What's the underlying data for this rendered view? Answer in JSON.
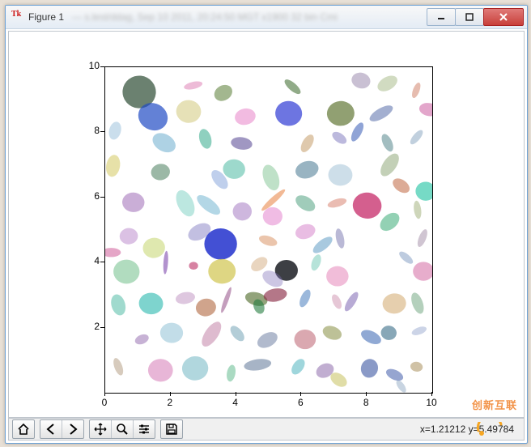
{
  "window": {
    "title": "Figure 1",
    "blurred_text": "— s.test/ddag, Sep 10 2011, 20:24:50  MGT x1900 32 bin  Cmi"
  },
  "win_buttons": {
    "minimize": "minimize-button",
    "maximize": "maximize-button",
    "close": "close-button"
  },
  "toolbar": {
    "home": "Home",
    "back": "Back",
    "forward": "Forward",
    "pan": "Pan",
    "zoom": "Zoom",
    "subplots": "Configure subplots",
    "save": "Save"
  },
  "status": {
    "coords": "x=1.21212   y=5.49784"
  },
  "watermark": "创新互联",
  "chart_data": {
    "type": "scatter",
    "title": "",
    "xlabel": "",
    "ylabel": "",
    "xlim": [
      0,
      10
    ],
    "ylim": [
      0,
      10
    ],
    "xticks": [
      0,
      2,
      4,
      6,
      8,
      10
    ],
    "yticks": [
      2,
      4,
      6,
      8,
      10
    ],
    "note": "100 translucent ellipses with random position, size, rotation, and color",
    "series": [
      {
        "x": 1.04,
        "y": 9.24,
        "rx": 0.51,
        "ry": 0.5,
        "angle": 6,
        "color": "#2c4c33",
        "alpha": 0.7
      },
      {
        "x": 2.69,
        "y": 9.44,
        "rx": 0.29,
        "ry": 0.11,
        "angle": 167,
        "color": "#d86aa8",
        "alpha": 0.46
      },
      {
        "x": 3.61,
        "y": 9.21,
        "rx": 0.23,
        "ry": 0.29,
        "angle": 60,
        "color": "#6a8a4b",
        "alpha": 0.62
      },
      {
        "x": 5.73,
        "y": 9.4,
        "rx": 0.12,
        "ry": 0.31,
        "angle": 131,
        "color": "#3a6a2b",
        "alpha": 0.56
      },
      {
        "x": 7.82,
        "y": 9.59,
        "rx": 0.29,
        "ry": 0.24,
        "angle": 15,
        "color": "#9482a7",
        "alpha": 0.5
      },
      {
        "x": 8.63,
        "y": 9.5,
        "rx": 0.33,
        "ry": 0.2,
        "angle": 150,
        "color": "#a3b884",
        "alpha": 0.5
      },
      {
        "x": 9.51,
        "y": 9.29,
        "rx": 0.1,
        "ry": 0.25,
        "angle": 21,
        "color": "#d1846b",
        "alpha": 0.54
      },
      {
        "x": 1.46,
        "y": 8.48,
        "rx": 0.46,
        "ry": 0.41,
        "angle": 28,
        "color": "#1d49c4",
        "alpha": 0.69
      },
      {
        "x": 2.55,
        "y": 8.64,
        "rx": 0.38,
        "ry": 0.35,
        "angle": 4,
        "color": "#d7ce8b",
        "alpha": 0.62
      },
      {
        "x": 4.28,
        "y": 8.48,
        "rx": 0.32,
        "ry": 0.25,
        "angle": 348,
        "color": "#e88acb",
        "alpha": 0.58
      },
      {
        "x": 5.61,
        "y": 8.58,
        "rx": 0.41,
        "ry": 0.38,
        "angle": 7,
        "color": "#1f2bd1",
        "alpha": 0.65
      },
      {
        "x": 7.2,
        "y": 8.58,
        "rx": 0.42,
        "ry": 0.38,
        "angle": 355,
        "color": "#667c3c",
        "alpha": 0.72
      },
      {
        "x": 8.44,
        "y": 8.58,
        "rx": 0.4,
        "ry": 0.16,
        "angle": 330,
        "color": "#3f579c",
        "alpha": 0.48
      },
      {
        "x": 9.9,
        "y": 8.7,
        "rx": 0.3,
        "ry": 0.2,
        "angle": 10,
        "color": "#cc5ca0",
        "alpha": 0.55
      },
      {
        "x": 0.3,
        "y": 8.05,
        "rx": 0.18,
        "ry": 0.28,
        "angle": 15,
        "color": "#8ab6d4",
        "alpha": 0.45
      },
      {
        "x": 1.8,
        "y": 7.68,
        "rx": 0.26,
        "ry": 0.38,
        "angle": 120,
        "color": "#4e9cc5",
        "alpha": 0.46
      },
      {
        "x": 3.06,
        "y": 7.8,
        "rx": 0.18,
        "ry": 0.31,
        "angle": 165,
        "color": "#33a98a",
        "alpha": 0.55
      },
      {
        "x": 4.17,
        "y": 7.66,
        "rx": 0.19,
        "ry": 0.33,
        "angle": 98,
        "color": "#5c4c96",
        "alpha": 0.58
      },
      {
        "x": 6.18,
        "y": 7.66,
        "rx": 0.15,
        "ry": 0.3,
        "angle": 30,
        "color": "#c59c6a",
        "alpha": 0.55
      },
      {
        "x": 7.16,
        "y": 7.83,
        "rx": 0.14,
        "ry": 0.25,
        "angle": 125,
        "color": "#7a73bb",
        "alpha": 0.5
      },
      {
        "x": 7.71,
        "y": 8.01,
        "rx": 0.13,
        "ry": 0.32,
        "angle": 28,
        "color": "#2b50b1",
        "alpha": 0.52
      },
      {
        "x": 8.63,
        "y": 7.68,
        "rx": 0.14,
        "ry": 0.29,
        "angle": 155,
        "color": "#3d757b",
        "alpha": 0.48
      },
      {
        "x": 9.52,
        "y": 7.85,
        "rx": 0.11,
        "ry": 0.27,
        "angle": 40,
        "color": "#6b8fb0",
        "alpha": 0.42
      },
      {
        "x": 0.24,
        "y": 6.97,
        "rx": 0.21,
        "ry": 0.34,
        "angle": 10,
        "color": "#d3c960",
        "alpha": 0.55
      },
      {
        "x": 1.69,
        "y": 6.78,
        "rx": 0.29,
        "ry": 0.25,
        "angle": 350,
        "color": "#4c8061",
        "alpha": 0.56
      },
      {
        "x": 3.94,
        "y": 6.87,
        "rx": 0.34,
        "ry": 0.3,
        "angle": 5,
        "color": "#49b9a1",
        "alpha": 0.54
      },
      {
        "x": 3.5,
        "y": 6.55,
        "rx": 0.18,
        "ry": 0.34,
        "angle": 142,
        "color": "#5e86d0",
        "alpha": 0.4
      },
      {
        "x": 5.07,
        "y": 6.61,
        "rx": 0.23,
        "ry": 0.41,
        "angle": 160,
        "color": "#7fc391",
        "alpha": 0.5
      },
      {
        "x": 6.17,
        "y": 6.85,
        "rx": 0.26,
        "ry": 0.36,
        "angle": 74,
        "color": "#2a627f",
        "alpha": 0.48
      },
      {
        "x": 7.19,
        "y": 6.69,
        "rx": 0.37,
        "ry": 0.33,
        "angle": 2,
        "color": "#a5c5d7",
        "alpha": 0.56
      },
      {
        "x": 8.7,
        "y": 7.0,
        "rx": 0.2,
        "ry": 0.4,
        "angle": 35,
        "color": "#6a8a4b",
        "alpha": 0.4
      },
      {
        "x": 9.05,
        "y": 6.36,
        "rx": 0.18,
        "ry": 0.29,
        "angle": 125,
        "color": "#c06640",
        "alpha": 0.55
      },
      {
        "x": 9.8,
        "y": 6.19,
        "rx": 0.31,
        "ry": 0.29,
        "angle": 5,
        "color": "#29c5a6",
        "alpha": 0.64
      },
      {
        "x": 0.86,
        "y": 5.85,
        "rx": 0.34,
        "ry": 0.3,
        "angle": 3,
        "color": "#a16fb7",
        "alpha": 0.56
      },
      {
        "x": 2.45,
        "y": 5.82,
        "rx": 0.24,
        "ry": 0.43,
        "angle": 155,
        "color": "#67c9b9",
        "alpha": 0.44
      },
      {
        "x": 3.16,
        "y": 5.77,
        "rx": 0.18,
        "ry": 0.43,
        "angle": 128,
        "color": "#49a0c3",
        "alpha": 0.42
      },
      {
        "x": 4.19,
        "y": 5.57,
        "rx": 0.29,
        "ry": 0.28,
        "angle": 1,
        "color": "#a77fc5",
        "alpha": 0.56
      },
      {
        "x": 5.12,
        "y": 5.42,
        "rx": 0.3,
        "ry": 0.28,
        "angle": 2,
        "color": "#e68bd0",
        "alpha": 0.58
      },
      {
        "x": 5.14,
        "y": 5.92,
        "rx": 0.09,
        "ry": 0.48,
        "angle": 48,
        "color": "#e6742b",
        "alpha": 0.5
      },
      {
        "x": 6.12,
        "y": 5.82,
        "rx": 0.2,
        "ry": 0.33,
        "angle": 122,
        "color": "#38956f",
        "alpha": 0.48
      },
      {
        "x": 7.09,
        "y": 5.83,
        "rx": 0.12,
        "ry": 0.3,
        "angle": 74,
        "color": "#d06a55",
        "alpha": 0.45
      },
      {
        "x": 8.01,
        "y": 5.75,
        "rx": 0.44,
        "ry": 0.4,
        "angle": 8,
        "color": "#c32162",
        "alpha": 0.72
      },
      {
        "x": 8.7,
        "y": 5.25,
        "rx": 0.22,
        "ry": 0.34,
        "angle": 50,
        "color": "#1d9e62",
        "alpha": 0.48
      },
      {
        "x": 9.55,
        "y": 5.62,
        "rx": 0.11,
        "ry": 0.28,
        "angle": 172,
        "color": "#8a9d5a",
        "alpha": 0.42
      },
      {
        "x": 0.72,
        "y": 4.81,
        "rx": 0.28,
        "ry": 0.25,
        "angle": 354,
        "color": "#bc8cce",
        "alpha": 0.54
      },
      {
        "x": 0.18,
        "y": 4.31,
        "rx": 0.14,
        "ry": 0.3,
        "angle": 90,
        "color": "#d46aa2",
        "alpha": 0.6
      },
      {
        "x": 1.49,
        "y": 4.45,
        "rx": 0.34,
        "ry": 0.31,
        "angle": 350,
        "color": "#c4d56e",
        "alpha": 0.55
      },
      {
        "x": 2.88,
        "y": 4.94,
        "rx": 0.37,
        "ry": 0.23,
        "angle": 152,
        "color": "#7b73be",
        "alpha": 0.46
      },
      {
        "x": 3.53,
        "y": 4.57,
        "rx": 0.5,
        "ry": 0.48,
        "angle": 0,
        "color": "#1a2acb",
        "alpha": 0.82
      },
      {
        "x": 4.98,
        "y": 4.67,
        "rx": 0.14,
        "ry": 0.29,
        "angle": 108,
        "color": "#d88c5a",
        "alpha": 0.5
      },
      {
        "x": 6.12,
        "y": 4.95,
        "rx": 0.31,
        "ry": 0.22,
        "angle": 342,
        "color": "#d37bc7",
        "alpha": 0.5
      },
      {
        "x": 6.65,
        "y": 4.54,
        "rx": 0.15,
        "ry": 0.36,
        "angle": 52,
        "color": "#3883b6",
        "alpha": 0.44
      },
      {
        "x": 7.18,
        "y": 4.74,
        "rx": 0.12,
        "ry": 0.31,
        "angle": 168,
        "color": "#6e6ca9",
        "alpha": 0.48
      },
      {
        "x": 9.7,
        "y": 4.75,
        "rx": 0.11,
        "ry": 0.29,
        "angle": 22,
        "color": "#8a6e8f",
        "alpha": 0.4
      },
      {
        "x": 0.65,
        "y": 3.72,
        "rx": 0.4,
        "ry": 0.37,
        "angle": 2,
        "color": "#3da85f",
        "alpha": 0.4
      },
      {
        "x": 1.85,
        "y": 4.0,
        "rx": 0.07,
        "ry": 0.36,
        "angle": 4,
        "color": "#7339a5",
        "alpha": 0.55
      },
      {
        "x": 2.7,
        "y": 3.9,
        "rx": 0.14,
        "ry": 0.12,
        "angle": 0,
        "color": "#c13c6e",
        "alpha": 0.64
      },
      {
        "x": 3.57,
        "y": 3.73,
        "rx": 0.42,
        "ry": 0.38,
        "angle": 0,
        "color": "#cfc248",
        "alpha": 0.68
      },
      {
        "x": 4.71,
        "y": 3.95,
        "rx": 0.18,
        "ry": 0.28,
        "angle": 55,
        "color": "#d2a77a",
        "alpha": 0.48
      },
      {
        "x": 5.54,
        "y": 3.76,
        "rx": 0.35,
        "ry": 0.32,
        "angle": 2,
        "color": "#1b1d23",
        "alpha": 0.85
      },
      {
        "x": 5.12,
        "y": 3.5,
        "rx": 0.21,
        "ry": 0.34,
        "angle": 120,
        "color": "#8071b9",
        "alpha": 0.4
      },
      {
        "x": 6.45,
        "y": 4.0,
        "rx": 0.13,
        "ry": 0.26,
        "angle": 20,
        "color": "#49b9a1",
        "alpha": 0.4
      },
      {
        "x": 7.1,
        "y": 3.58,
        "rx": 0.34,
        "ry": 0.31,
        "angle": 0,
        "color": "#e480b6",
        "alpha": 0.52
      },
      {
        "x": 9.73,
        "y": 3.73,
        "rx": 0.32,
        "ry": 0.29,
        "angle": 0,
        "color": "#d36aa2",
        "alpha": 0.55
      },
      {
        "x": 9.2,
        "y": 4.15,
        "rx": 0.11,
        "ry": 0.26,
        "angle": 130,
        "color": "#5a7db0",
        "alpha": 0.4
      },
      {
        "x": 0.4,
        "y": 2.7,
        "rx": 0.21,
        "ry": 0.33,
        "angle": 164,
        "color": "#38b198",
        "alpha": 0.48
      },
      {
        "x": 1.4,
        "y": 2.74,
        "rx": 0.37,
        "ry": 0.33,
        "angle": 6,
        "color": "#2ebab0",
        "alpha": 0.62
      },
      {
        "x": 2.45,
        "y": 2.91,
        "rx": 0.3,
        "ry": 0.18,
        "angle": 170,
        "color": "#b079b2",
        "alpha": 0.42
      },
      {
        "x": 3.08,
        "y": 2.62,
        "rx": 0.31,
        "ry": 0.27,
        "angle": 348,
        "color": "#b16740",
        "alpha": 0.6
      },
      {
        "x": 3.7,
        "y": 2.85,
        "rx": 0.07,
        "ry": 0.42,
        "angle": 20,
        "color": "#8a3e7b",
        "alpha": 0.5
      },
      {
        "x": 4.62,
        "y": 2.88,
        "rx": 0.2,
        "ry": 0.35,
        "angle": 105,
        "color": "#556f31",
        "alpha": 0.64
      },
      {
        "x": 4.7,
        "y": 2.65,
        "rx": 0.23,
        "ry": 0.16,
        "angle": 70,
        "color": "#257d3f",
        "alpha": 0.6
      },
      {
        "x": 5.2,
        "y": 3.0,
        "rx": 0.36,
        "ry": 0.2,
        "angle": 170,
        "color": "#8a2a45",
        "alpha": 0.64
      },
      {
        "x": 6.11,
        "y": 2.9,
        "rx": 0.13,
        "ry": 0.29,
        "angle": 24,
        "color": "#2162b0",
        "alpha": 0.45
      },
      {
        "x": 7.08,
        "y": 2.8,
        "rx": 0.12,
        "ry": 0.24,
        "angle": 155,
        "color": "#c37a9e",
        "alpha": 0.42
      },
      {
        "x": 7.53,
        "y": 2.8,
        "rx": 0.12,
        "ry": 0.34,
        "angle": 32,
        "color": "#6b4fa8",
        "alpha": 0.48
      },
      {
        "x": 8.84,
        "y": 2.74,
        "rx": 0.36,
        "ry": 0.31,
        "angle": 355,
        "color": "#d2a86b",
        "alpha": 0.55
      },
      {
        "x": 9.55,
        "y": 2.75,
        "rx": 0.16,
        "ry": 0.34,
        "angle": 160,
        "color": "#4d8f5f",
        "alpha": 0.42
      },
      {
        "x": 1.12,
        "y": 1.64,
        "rx": 0.14,
        "ry": 0.22,
        "angle": 68,
        "color": "#895fa7",
        "alpha": 0.48
      },
      {
        "x": 2.03,
        "y": 1.84,
        "rx": 0.35,
        "ry": 0.31,
        "angle": 2,
        "color": "#8fc1d6",
        "alpha": 0.55
      },
      {
        "x": 3.25,
        "y": 1.8,
        "rx": 0.2,
        "ry": 0.44,
        "angle": 34,
        "color": "#b66a97",
        "alpha": 0.46
      },
      {
        "x": 4.04,
        "y": 1.82,
        "rx": 0.15,
        "ry": 0.28,
        "angle": 140,
        "color": "#4b88a0",
        "alpha": 0.42
      },
      {
        "x": 4.96,
        "y": 1.62,
        "rx": 0.33,
        "ry": 0.21,
        "angle": 152,
        "color": "#3d5283",
        "alpha": 0.4
      },
      {
        "x": 6.11,
        "y": 1.64,
        "rx": 0.33,
        "ry": 0.3,
        "angle": 0,
        "color": "#bc6170",
        "alpha": 0.55
      },
      {
        "x": 6.94,
        "y": 1.84,
        "rx": 0.2,
        "ry": 0.3,
        "angle": 110,
        "color": "#818837",
        "alpha": 0.52
      },
      {
        "x": 8.13,
        "y": 1.71,
        "rx": 0.33,
        "ry": 0.18,
        "angle": 26,
        "color": "#2a5aac",
        "alpha": 0.52
      },
      {
        "x": 8.67,
        "y": 1.84,
        "rx": 0.24,
        "ry": 0.22,
        "angle": 6,
        "color": "#2b627e",
        "alpha": 0.56
      },
      {
        "x": 9.6,
        "y": 1.9,
        "rx": 0.11,
        "ry": 0.24,
        "angle": 70,
        "color": "#8093c2",
        "alpha": 0.4
      },
      {
        "x": 0.4,
        "y": 0.8,
        "rx": 0.12,
        "ry": 0.28,
        "angle": 160,
        "color": "#9a7c5a",
        "alpha": 0.4
      },
      {
        "x": 1.69,
        "y": 0.69,
        "rx": 0.38,
        "ry": 0.35,
        "angle": 2,
        "color": "#d67ab7",
        "alpha": 0.55
      },
      {
        "x": 2.75,
        "y": 0.75,
        "rx": 0.4,
        "ry": 0.37,
        "angle": 355,
        "color": "#71b7c2",
        "alpha": 0.55
      },
      {
        "x": 3.85,
        "y": 0.6,
        "rx": 0.13,
        "ry": 0.26,
        "angle": 10,
        "color": "#4db180",
        "alpha": 0.48
      },
      {
        "x": 4.66,
        "y": 0.86,
        "rx": 0.42,
        "ry": 0.17,
        "angle": 172,
        "color": "#36557d",
        "alpha": 0.44
      },
      {
        "x": 5.9,
        "y": 0.8,
        "rx": 0.16,
        "ry": 0.27,
        "angle": 35,
        "color": "#37a9b5",
        "alpha": 0.48
      },
      {
        "x": 6.72,
        "y": 0.68,
        "rx": 0.28,
        "ry": 0.21,
        "angle": 155,
        "color": "#8864a7",
        "alpha": 0.52
      },
      {
        "x": 7.14,
        "y": 0.4,
        "rx": 0.18,
        "ry": 0.28,
        "angle": 125,
        "color": "#c7c15e",
        "alpha": 0.55
      },
      {
        "x": 8.08,
        "y": 0.75,
        "rx": 0.26,
        "ry": 0.29,
        "angle": 15,
        "color": "#2e4b9c",
        "alpha": 0.56
      },
      {
        "x": 8.85,
        "y": 0.55,
        "rx": 0.28,
        "ry": 0.15,
        "angle": 25,
        "color": "#3553a4",
        "alpha": 0.52
      },
      {
        "x": 9.52,
        "y": 0.8,
        "rx": 0.19,
        "ry": 0.15,
        "angle": 10,
        "color": "#9c8045",
        "alpha": 0.48
      },
      {
        "x": 9.05,
        "y": 0.2,
        "rx": 0.1,
        "ry": 0.22,
        "angle": 145,
        "color": "#6e8db0",
        "alpha": 0.38
      }
    ]
  }
}
